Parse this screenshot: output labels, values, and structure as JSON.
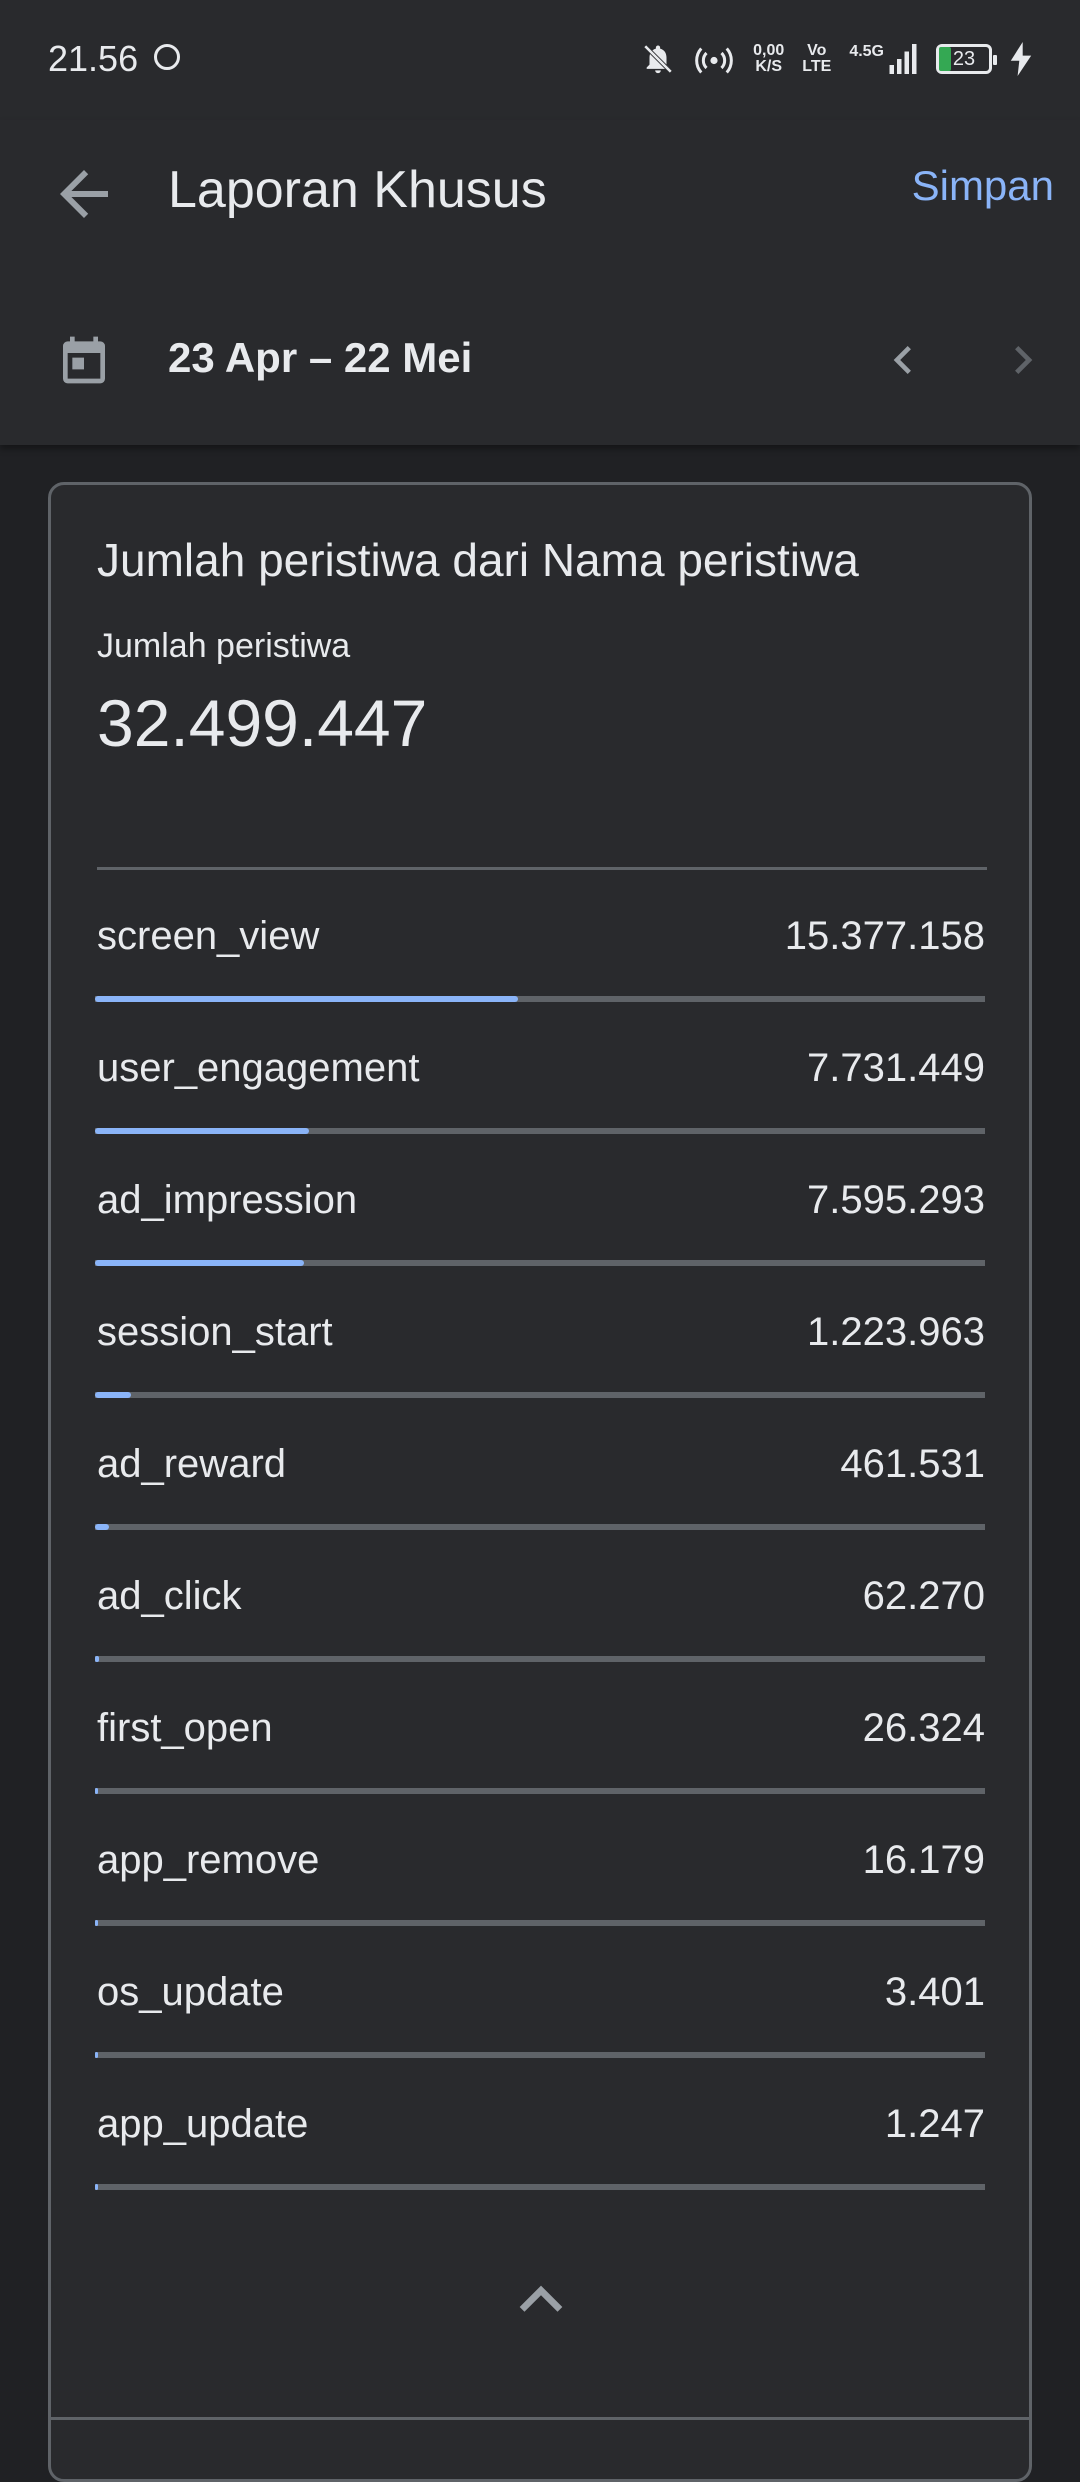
{
  "status_bar": {
    "time": "21.56",
    "speed_value": "0,00",
    "speed_unit": "K/S",
    "volte_top": "Vo",
    "volte_bottom": "LTE",
    "network": "4.5G",
    "battery": "23",
    "battery_level": 0.23,
    "battery_color": "#34a853"
  },
  "header": {
    "title": "Laporan Khusus",
    "save_label": "Simpan",
    "date_range": "23 Apr – 22 Mei"
  },
  "card": {
    "title": "Jumlah peristiwa dari Nama peristiwa",
    "metric_label": "Jumlah peristiwa",
    "metric_total": "32.499.447",
    "rows": [
      {
        "name": "screen_view",
        "value": "15.377.158",
        "share": 0.475
      },
      {
        "name": "user_engagement",
        "value": "7.731.449",
        "share": 0.24
      },
      {
        "name": "ad_impression",
        "value": "7.595.293",
        "share": 0.235
      },
      {
        "name": "session_start",
        "value": "1.223.963",
        "share": 0.04
      },
      {
        "name": "ad_reward",
        "value": "461.531",
        "share": 0.016
      },
      {
        "name": "ad_click",
        "value": "62.270",
        "share": 0.004
      },
      {
        "name": "first_open",
        "value": "26.324",
        "share": 0.003
      },
      {
        "name": "app_remove",
        "value": "16.179",
        "share": 0.003
      },
      {
        "name": "os_update",
        "value": "3.401",
        "share": 0.003
      },
      {
        "name": "app_update",
        "value": "1.247",
        "share": 0.003
      }
    ]
  },
  "colors": {
    "accent": "#8ab4f8",
    "background": "#202124",
    "surface": "#292a2d",
    "divider": "#5f6368"
  },
  "icons": [
    "back-arrow-icon",
    "calendar-icon",
    "chevron-left-icon",
    "chevron-right-icon",
    "chevron-up-icon",
    "bell-off-icon",
    "hotspot-icon",
    "signal-icon",
    "charging-icon"
  ]
}
